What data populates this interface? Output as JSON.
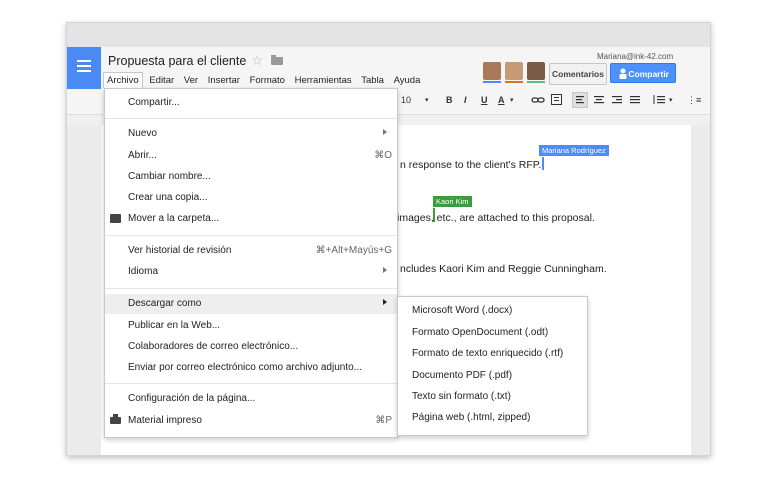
{
  "doc": {
    "title": "Propuesta para el cliente",
    "menubar": [
      "Archivo",
      "Editar",
      "Ver",
      "Insertar",
      "Formato",
      "Herramientas",
      "Tabla",
      "Ayuda"
    ],
    "account_email": "Mariana@ink-42.com",
    "comments_label": "Comentarios",
    "share_label": "Compartir",
    "avatar_colors": [
      "#4e8bf5",
      "#e7711b",
      "#57bb8a"
    ]
  },
  "toolbar": {
    "font_size": "10",
    "bold": "B",
    "italic": "I",
    "underline": "U",
    "text_color": "A"
  },
  "document_lines": [
    "n response to the client's RFP.",
    "images, etc., are attached to this proposal.",
    "ncludes Kaori Kim and Reggie Cunningham."
  ],
  "collaborators": [
    {
      "name": "Mariana Rodríguez",
      "color": "#4e8bf5"
    },
    {
      "name": "Kaori Kim",
      "color": "#3a9c3a"
    }
  ],
  "file_menu": {
    "share": "Compartir...",
    "new": "Nuevo",
    "open": "Abrir...",
    "open_shortcut": "⌘O",
    "rename": "Cambiar nombre...",
    "copy": "Crear una copia...",
    "move": "Mover a la carpeta...",
    "history": "Ver historial de revisión",
    "history_shortcut": "⌘+Alt+Mayús+G",
    "language": "Idioma",
    "download": "Descargar como",
    "publish": "Publicar en la Web...",
    "email_collab": "Colaboradores de correo electrónico...",
    "email_attach": "Enviar por correo electrónico como archivo adjunto...",
    "page_setup": "Configuración de la página...",
    "print": "Material impreso",
    "print_shortcut": "⌘P"
  },
  "download_submenu": [
    "Microsoft Word (.docx)",
    "Formato OpenDocument (.odt)",
    "Formato de texto enriquecido (.rtf)",
    "Documento PDF (.pdf)",
    "Texto sin formato (.txt)",
    "Página web (.html, zipped)"
  ]
}
